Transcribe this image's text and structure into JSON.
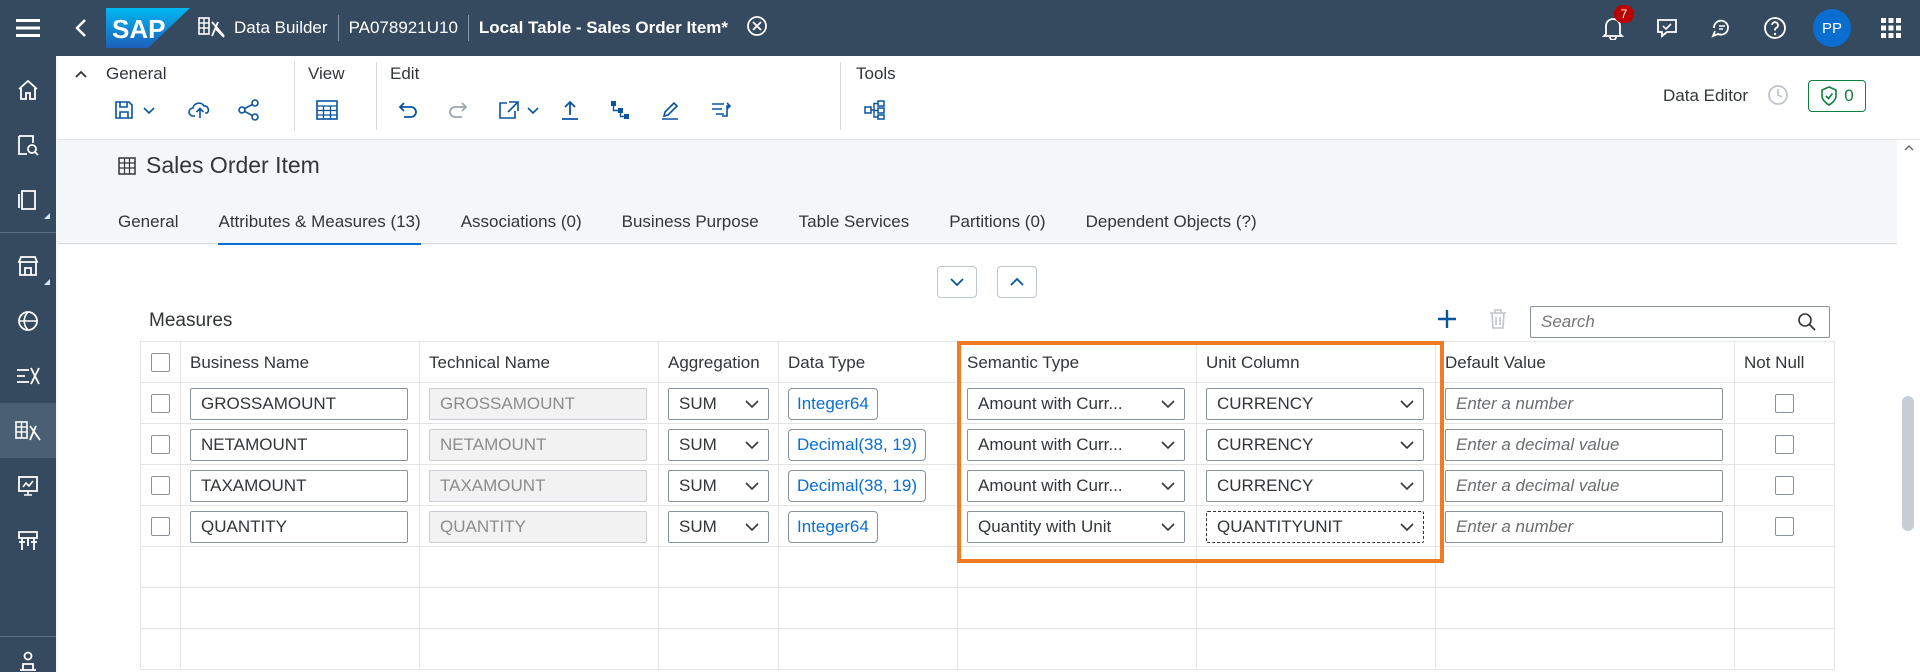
{
  "shell": {
    "logo_text": "SAP",
    "app_name": "Data Builder",
    "space": "PA078921U10",
    "title": "Local Table - Sales Order Item",
    "unsaved_marker": "*",
    "notification_count": "7",
    "avatar_initials": "PP"
  },
  "leftnav": {
    "items": [
      "home-icon",
      "catalog-search-icon",
      "repository-icon",
      "marketplace-icon",
      "business-builder-icon",
      "data-access-icon",
      "data-builder-icon",
      "data-integration-icon",
      "space-management-icon",
      "system-monitor-icon"
    ]
  },
  "toolbar": {
    "groups": {
      "general": "General",
      "view": "View",
      "edit": "Edit",
      "tools": "Tools"
    },
    "data_editor": "Data Editor",
    "validation_count": "0"
  },
  "object": {
    "title": "Sales Order Item",
    "tabs": [
      {
        "label": "General",
        "active": false
      },
      {
        "label": "Attributes & Measures (13)",
        "active": true
      },
      {
        "label": "Associations (0)",
        "active": false
      },
      {
        "label": "Business Purpose",
        "active": false
      },
      {
        "label": "Table Services",
        "active": false
      },
      {
        "label": "Partitions (0)",
        "active": false
      },
      {
        "label": "Dependent Objects (?)",
        "active": false
      }
    ]
  },
  "measures": {
    "title": "Measures",
    "search_placeholder": "Search",
    "columns": [
      "Business Name",
      "Technical Name",
      "Aggregation",
      "Data Type",
      "Semantic Type",
      "Unit Column",
      "Default Value",
      "Not Null"
    ],
    "rows": [
      {
        "business_name": "GROSSAMOUNT",
        "technical_name": "GROSSAMOUNT",
        "aggregation": "SUM",
        "data_type": "Integer64",
        "semantic_type": "Amount with Curr...",
        "unit_column": "CURRENCY",
        "default_placeholder": "Enter a number"
      },
      {
        "business_name": "NETAMOUNT",
        "technical_name": "NETAMOUNT",
        "aggregation": "SUM",
        "data_type": "Decimal(38, 19)",
        "semantic_type": "Amount with Curr...",
        "unit_column": "CURRENCY",
        "default_placeholder": "Enter a decimal value"
      },
      {
        "business_name": "TAXAMOUNT",
        "technical_name": "TAXAMOUNT",
        "aggregation": "SUM",
        "data_type": "Decimal(38, 19)",
        "semantic_type": "Amount with Curr...",
        "unit_column": "CURRENCY",
        "default_placeholder": "Enter a decimal value"
      },
      {
        "business_name": "QUANTITY",
        "technical_name": "QUANTITY",
        "aggregation": "SUM",
        "data_type": "Integer64",
        "semantic_type": "Quantity with Unit",
        "unit_column": "QUANTITYUNIT",
        "default_placeholder": "Enter a number"
      }
    ]
  },
  "colors": {
    "shell": "#354a5f",
    "accent": "#0a6ed1",
    "highlight": "#f07b22",
    "positive": "#107e3e",
    "notification": "#bb0000"
  }
}
